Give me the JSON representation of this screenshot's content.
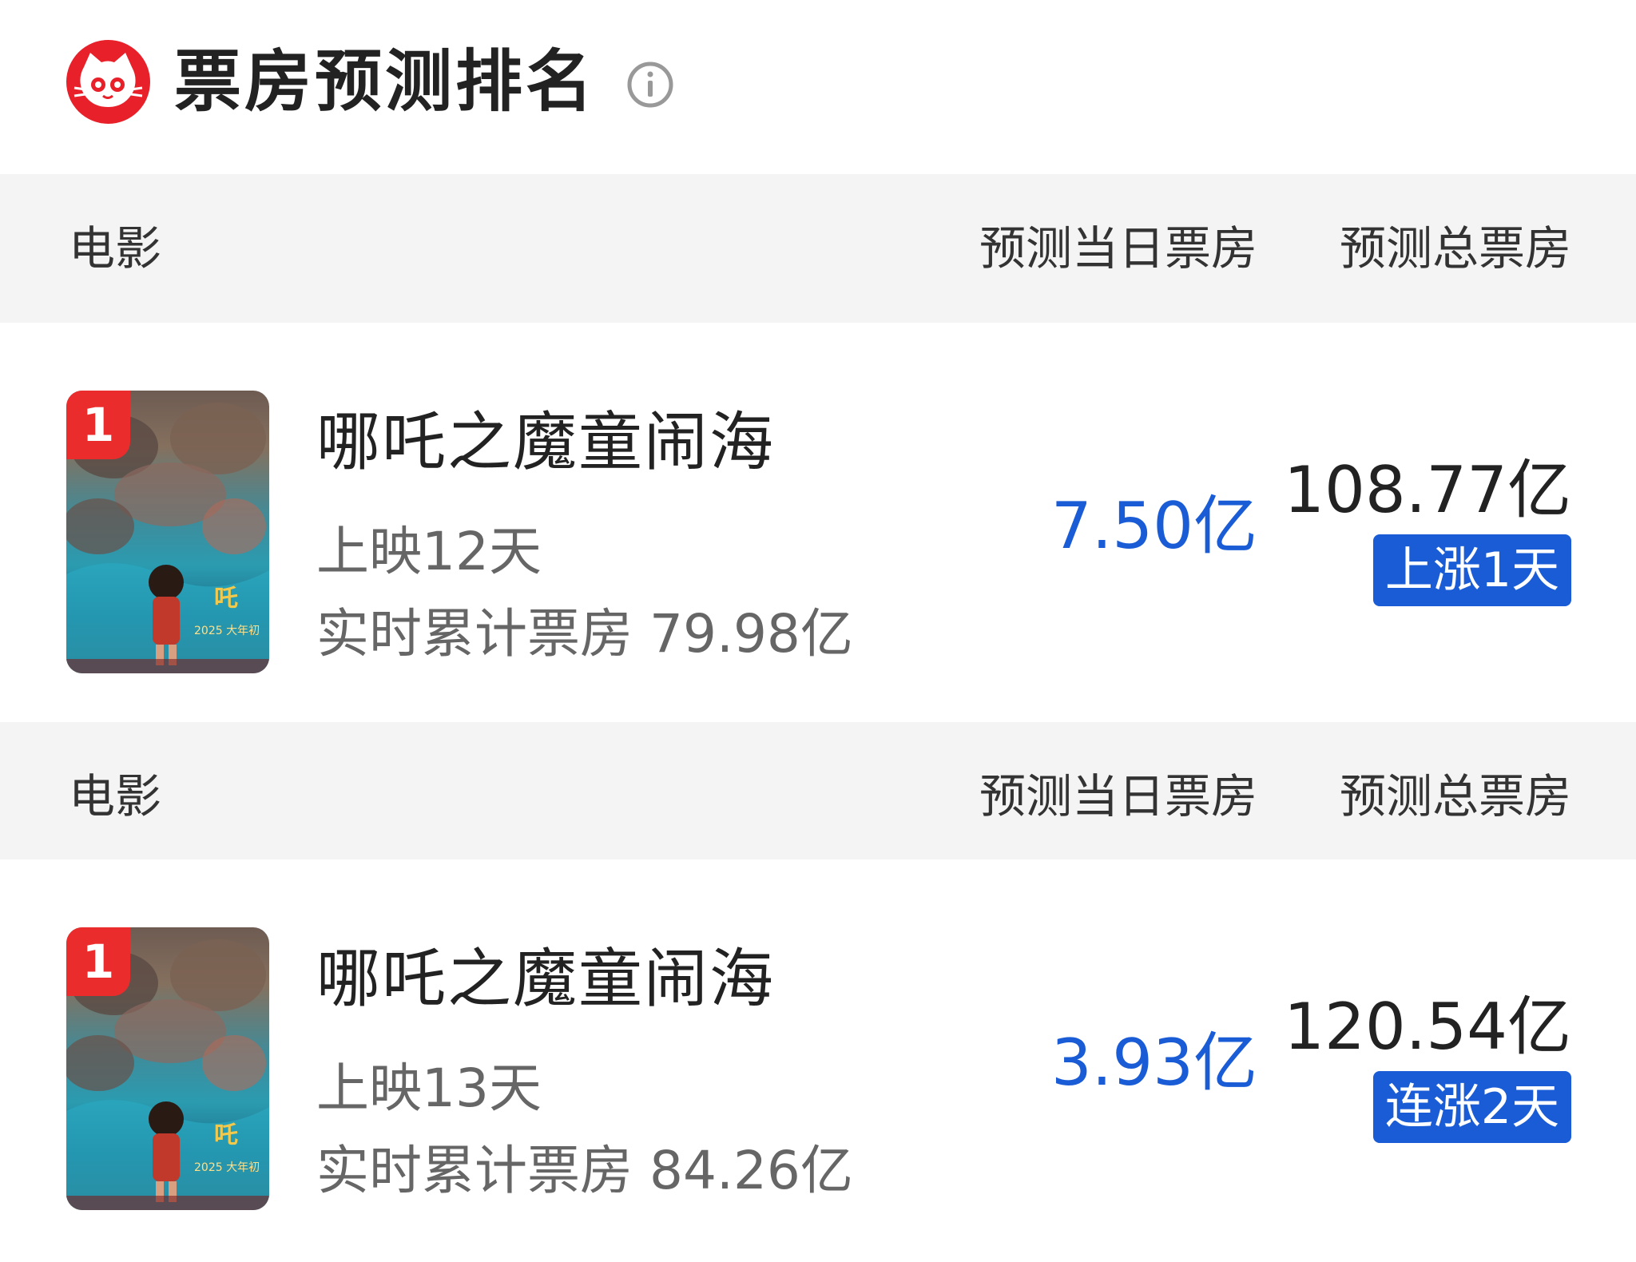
{
  "header": {
    "title": "票房预测排名",
    "logo_icon": "maoyan-cat-icon",
    "info_icon": "info-icon",
    "brand_color": "#e8202a"
  },
  "columns": {
    "movie": "电影",
    "daily": "预测当日票房",
    "total": "预测总票房"
  },
  "entries": [
    {
      "rank": "1",
      "name": "哪吒之魔童闹海",
      "days": "上映12天",
      "cumulative": "实时累计票房 79.98亿",
      "daily_forecast": "7.50亿",
      "total_forecast": "108.77亿",
      "trend": "上涨1天"
    },
    {
      "rank": "1",
      "name": "哪吒之魔童闹海",
      "days": "上映13天",
      "cumulative": "实时累计票房 84.26亿",
      "daily_forecast": "3.93亿",
      "total_forecast": "120.54亿",
      "trend": "连涨2天"
    }
  ],
  "colors": {
    "accent_blue": "#1a5cd6",
    "rank_badge": "#ea2c2c",
    "header_bg": "#f4f4f4"
  }
}
